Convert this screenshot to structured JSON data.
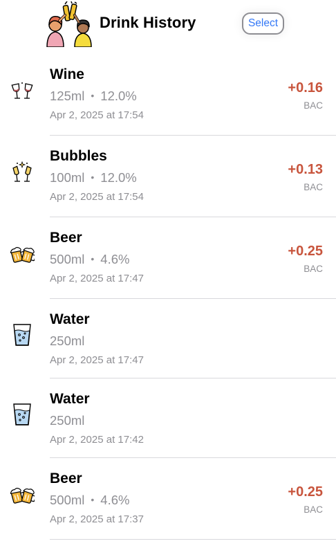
{
  "header": {
    "title": "Drink History",
    "select_label": "Select"
  },
  "colors": {
    "accent": "#3478f6",
    "bac": "#c8553d",
    "secondary": "#8e8e93"
  },
  "drinks": [
    {
      "icon": "wine-glasses-icon",
      "name": "Wine",
      "volume": "125ml",
      "abv": "12.0%",
      "time": "Apr 2, 2025 at 17:54",
      "bac": "+0.16",
      "bac_label": "BAC"
    },
    {
      "icon": "champagne-glasses-icon",
      "name": "Bubbles",
      "volume": "100ml",
      "abv": "12.0%",
      "time": "Apr 2, 2025 at 17:54",
      "bac": "+0.13",
      "bac_label": "BAC"
    },
    {
      "icon": "beer-mugs-icon",
      "name": "Beer",
      "volume": "500ml",
      "abv": "4.6%",
      "time": "Apr 2, 2025 at 17:47",
      "bac": "+0.25",
      "bac_label": "BAC"
    },
    {
      "icon": "water-glass-icon",
      "name": "Water",
      "volume": "250ml",
      "time": "Apr 2, 2025 at 17:47"
    },
    {
      "icon": "water-glass-icon",
      "name": "Water",
      "volume": "250ml",
      "time": "Apr 2, 2025 at 17:42"
    },
    {
      "icon": "beer-mugs-icon",
      "name": "Beer",
      "volume": "500ml",
      "abv": "4.6%",
      "time": "Apr 2, 2025 at 17:37",
      "bac": "+0.25",
      "bac_label": "BAC"
    }
  ]
}
